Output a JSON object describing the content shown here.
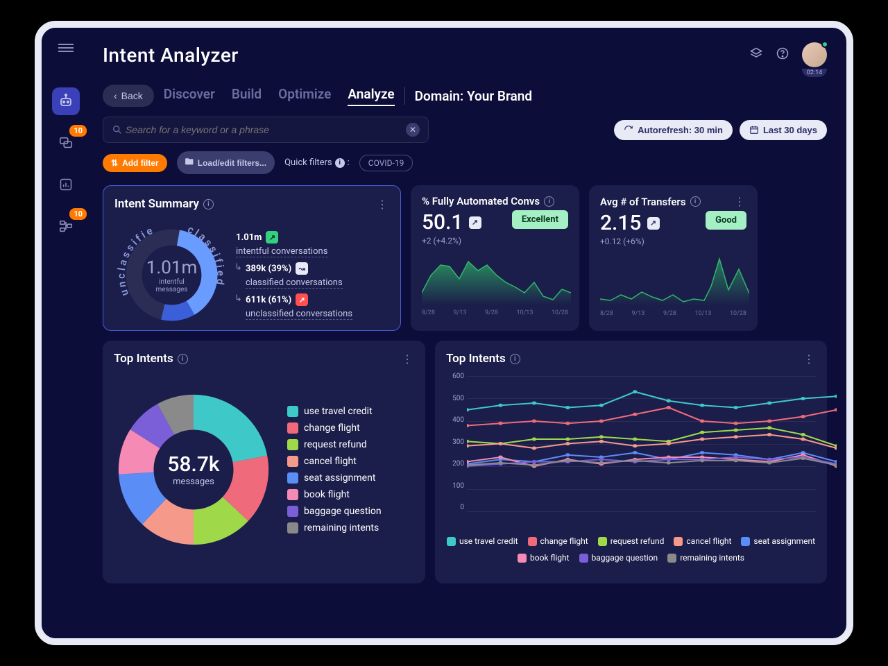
{
  "header": {
    "title": "Intent Analyzer",
    "timer": "02:14"
  },
  "sidebar": {
    "badges": {
      "chat": "10",
      "flow": "10"
    }
  },
  "topbar": {
    "back": "Back",
    "tabs": [
      "Discover",
      "Build",
      "Optimize",
      "Analyze"
    ],
    "activeTab": 3,
    "domain_label": "Domain: Your Brand"
  },
  "search": {
    "placeholder": "Search for a keyword or a phrase"
  },
  "controls": {
    "autorefresh": "Autorefresh: 30 min",
    "daterange": "Last 30 days",
    "add_filter": "Add filter",
    "load_filters": "Load/edit filters...",
    "quick_filters_label": "Quick filters",
    "quick_filter_chip": "COVID-19"
  },
  "intent_summary": {
    "title": "Intent Summary",
    "center_value": "1.01m",
    "center_label": "intentful\nmessages",
    "total_value": "1.01m",
    "total_desc": "intentful conversations",
    "classified_value": "389k (39%)",
    "classified_desc": "classified conversations",
    "unclassified_value": "611k (61%)",
    "unclassified_desc": "unclassified conversations",
    "arc_classified": "classified",
    "arc_unclassified": "unclassified"
  },
  "kpi_auto": {
    "title": "% Fully Automated Convs",
    "value": "50.1",
    "badge": "Excellent",
    "delta": "+2 (+4.2%)"
  },
  "kpi_transfers": {
    "title": "Avg # of Transfers",
    "value": "2.15",
    "badge": "Good",
    "delta": "+0.12 (+6%)"
  },
  "kpi_axis": [
    "8/28",
    "9/13",
    "9/28",
    "10/13",
    "10/28"
  ],
  "top_intents_donut": {
    "title": "Top Intents",
    "center_value": "58.7k",
    "center_label": "messages"
  },
  "top_intents_line": {
    "title": "Top Intents"
  },
  "intent_legend": [
    {
      "label": "use travel credit",
      "color": "#3fc8c8"
    },
    {
      "label": "change flight",
      "color": "#ef6b7b"
    },
    {
      "label": "request refund",
      "color": "#9fd94a"
    },
    {
      "label": "cancel flight",
      "color": "#f59a8a"
    },
    {
      "label": "seat assignment",
      "color": "#5a8df5"
    },
    {
      "label": "book flight",
      "color": "#f58ab5"
    },
    {
      "label": "baggage question",
      "color": "#7a5fd8"
    },
    {
      "label": "remaining intents",
      "color": "#8a8a8a"
    }
  ],
  "chart_data": {
    "intent_summary_donut": {
      "type": "pie",
      "title": "Intent Summary",
      "series": [
        {
          "name": "classified",
          "value": 389000,
          "pct": 39
        },
        {
          "name": "unclassified",
          "value": 611000,
          "pct": 61
        }
      ],
      "total": 1010000
    },
    "kpi_auto_spark": {
      "type": "area",
      "x": [
        "8/28",
        "9/13",
        "9/28",
        "10/13",
        "10/28"
      ],
      "values": [
        30,
        55,
        70,
        68,
        50,
        75,
        60,
        70,
        55,
        45,
        38,
        30,
        45,
        25,
        20,
        35
      ],
      "ylim": [
        0,
        100
      ]
    },
    "kpi_transfers_spark": {
      "type": "area",
      "x": [
        "8/28",
        "9/13",
        "9/28",
        "10/13",
        "10/28"
      ],
      "values": [
        0.8,
        0.6,
        1.0,
        0.7,
        1.2,
        0.9,
        0.7,
        1.0,
        0.6,
        0.8,
        0.7,
        1.5,
        3.2,
        1.2,
        2.6
      ],
      "ylim": [
        0,
        4
      ]
    },
    "top_intents_donut": {
      "type": "pie",
      "title": "Top Intents",
      "total_label": "58.7k messages",
      "series": [
        {
          "name": "use travel credit",
          "pct": 22,
          "color": "#3fc8c8"
        },
        {
          "name": "change flight",
          "pct": 15,
          "color": "#ef6b7b"
        },
        {
          "name": "request refund",
          "pct": 13,
          "color": "#9fd94a"
        },
        {
          "name": "cancel flight",
          "pct": 12,
          "color": "#f59a8a"
        },
        {
          "name": "seat assignment",
          "pct": 12,
          "color": "#5a8df5"
        },
        {
          "name": "book flight",
          "pct": 10,
          "color": "#f58ab5"
        },
        {
          "name": "baggage question",
          "pct": 8,
          "color": "#7a5fd8"
        },
        {
          "name": "remaining intents",
          "pct": 8,
          "color": "#8a8a8a"
        }
      ]
    },
    "top_intents_line": {
      "type": "line",
      "ylabel": "",
      "ylim": [
        0,
        600
      ],
      "yticks": [
        0,
        100,
        200,
        300,
        400,
        500,
        600
      ],
      "x_index": [
        0,
        1,
        2,
        3,
        4,
        5,
        6,
        7,
        8,
        9,
        10,
        11
      ],
      "series": [
        {
          "name": "use travel credit",
          "color": "#3fc8c8",
          "values": [
            450,
            470,
            480,
            460,
            470,
            530,
            490,
            470,
            460,
            480,
            500,
            510
          ]
        },
        {
          "name": "change flight",
          "color": "#ef6b7b",
          "values": [
            380,
            390,
            400,
            390,
            400,
            430,
            460,
            400,
            390,
            400,
            420,
            450
          ]
        },
        {
          "name": "request refund",
          "color": "#9fd94a",
          "values": [
            310,
            300,
            320,
            320,
            330,
            320,
            310,
            350,
            360,
            370,
            340,
            290
          ]
        },
        {
          "name": "cancel flight",
          "color": "#f59a8a",
          "values": [
            290,
            300,
            280,
            300,
            310,
            290,
            300,
            320,
            330,
            340,
            320,
            280
          ]
        },
        {
          "name": "seat assignment",
          "color": "#5a8df5",
          "values": [
            210,
            230,
            220,
            250,
            240,
            260,
            230,
            260,
            250,
            230,
            260,
            220
          ]
        },
        {
          "name": "book flight",
          "color": "#f58ab5",
          "values": [
            220,
            240,
            200,
            230,
            210,
            230,
            240,
            240,
            230,
            220,
            250,
            200
          ]
        },
        {
          "name": "baggage question",
          "color": "#7a5fd8",
          "values": [
            200,
            210,
            220,
            220,
            230,
            220,
            230,
            230,
            240,
            230,
            240,
            210
          ]
        },
        {
          "name": "remaining intents",
          "color": "#8a8a8a",
          "values": [
            205,
            215,
            205,
            225,
            215,
            225,
            215,
            225,
            225,
            215,
            235,
            205
          ]
        }
      ]
    }
  }
}
